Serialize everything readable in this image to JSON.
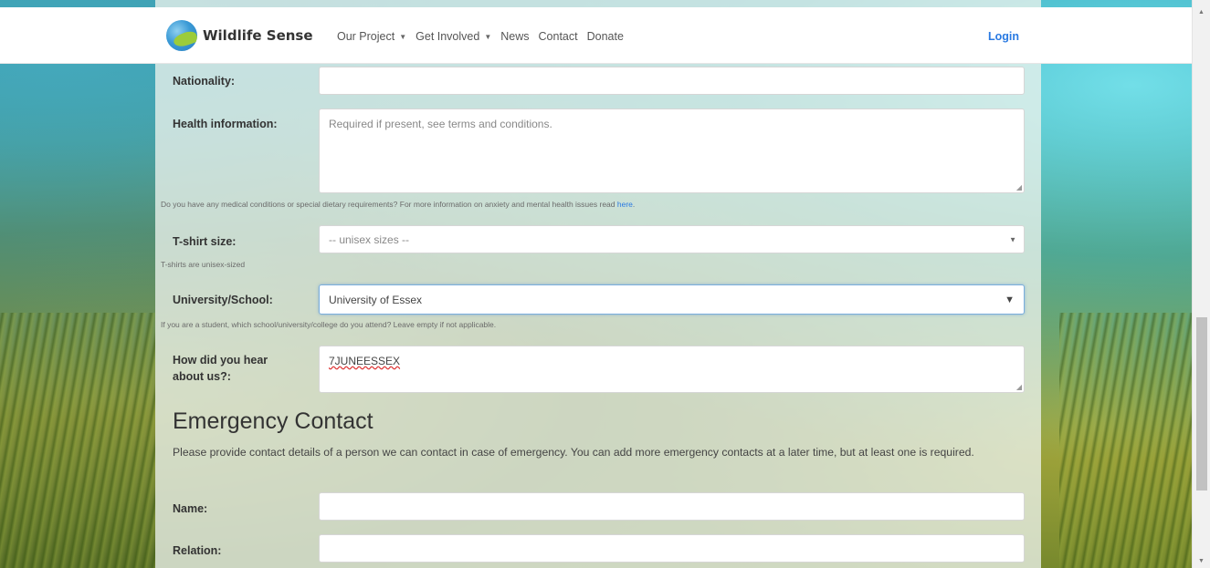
{
  "nav": {
    "brand": "Wildlife Sense",
    "items": [
      {
        "label": "Our Project",
        "dropdown": true
      },
      {
        "label": "Get Involved",
        "dropdown": true
      },
      {
        "label": "News",
        "dropdown": false
      },
      {
        "label": "Contact",
        "dropdown": false
      },
      {
        "label": "Donate",
        "dropdown": false
      }
    ],
    "login": "Login"
  },
  "form": {
    "nationality": {
      "label": "Nationality:",
      "value": ""
    },
    "health": {
      "label": "Health information:",
      "placeholder": "Required if present, see terms and conditions.",
      "help": "Do you have any medical conditions or special dietary requirements? For more information on anxiety and mental health issues read ",
      "help_link": "here",
      "help_end": "."
    },
    "tshirt": {
      "label": "T-shirt size:",
      "value": "-- unisex sizes --",
      "help": "T-shirts are unisex-sized"
    },
    "university": {
      "label": "University/School:",
      "value": "University of Essex",
      "help": "If you are a student, which school/university/college do you attend? Leave empty if not applicable."
    },
    "hear": {
      "label_line1": "How did you hear",
      "label_line2": "about us?:",
      "value": "7JUNEESSEX"
    }
  },
  "emergency": {
    "title": "Emergency Contact",
    "description": "Please provide contact details of a person we can contact in case of emergency. You can add more emergency contacts at a later time, but at least one is required.",
    "name": {
      "label": "Name:",
      "value": ""
    },
    "relation": {
      "label": "Relation:",
      "value": ""
    }
  },
  "icons": {
    "caret": "caret-down-icon",
    "select": "chevron-down-icon"
  }
}
